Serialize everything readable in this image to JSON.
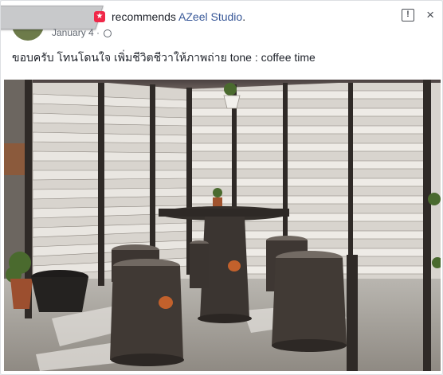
{
  "post": {
    "recommends_text": "recommends",
    "page_name": "AZeel Studio",
    "date": "January 4",
    "separator": "·",
    "badge_glyph": "★",
    "icons": [
      "recommend-badge-icon",
      "globe-icon",
      "report-icon",
      "close-icon"
    ],
    "text": "ขอบครับ โทนโดนใจ เพิ่มชีวิตชีวาให้ภาพถ่าย tone : coffee time"
  },
  "toolbar": {
    "report_glyph": "!",
    "close_glyph": "×"
  },
  "colors": {
    "link": "#385898",
    "badge": "#f02849",
    "text": "#1d2129",
    "meta": "#616770"
  }
}
